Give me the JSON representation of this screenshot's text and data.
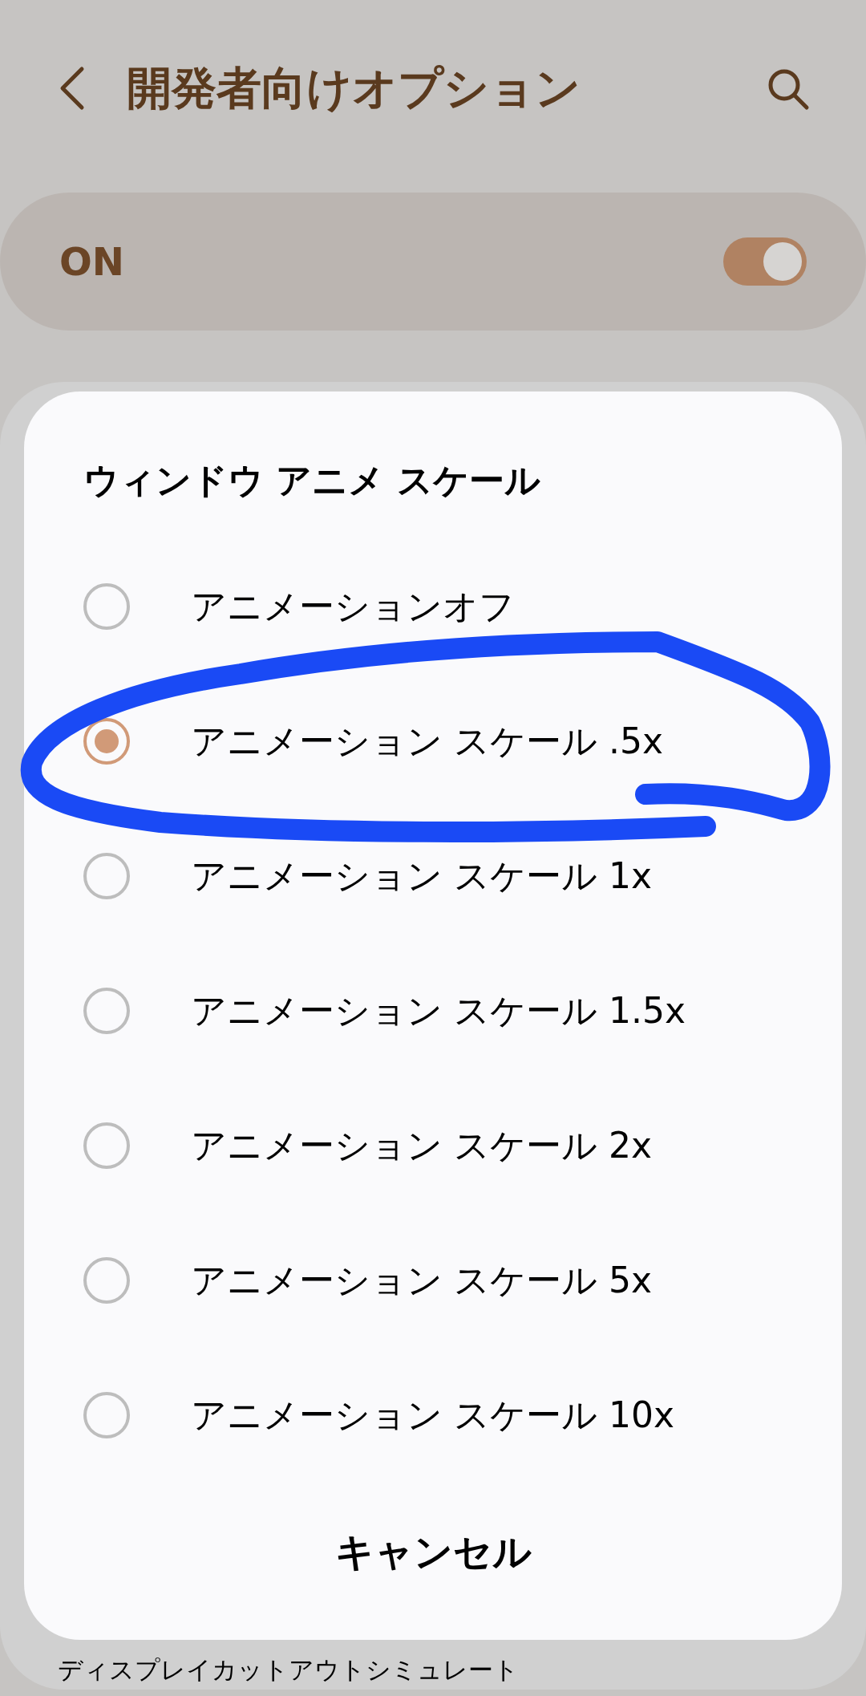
{
  "header": {
    "title": "開発者向けオプション"
  },
  "master_switch": {
    "label": "ON",
    "on": true
  },
  "dialog": {
    "title": "ウィンドウ アニメ スケール",
    "options": [
      {
        "label": "アニメーションオフ",
        "selected": false
      },
      {
        "label": "アニメーション スケール .5x",
        "selected": true
      },
      {
        "label": "アニメーション スケール 1x",
        "selected": false
      },
      {
        "label": "アニメーション スケール 1.5x",
        "selected": false
      },
      {
        "label": "アニメーション スケール 2x",
        "selected": false
      },
      {
        "label": "アニメーション スケール 5x",
        "selected": false
      },
      {
        "label": "アニメーション スケール 10x",
        "selected": false
      }
    ],
    "cancel": "キャンセル"
  },
  "background_item": {
    "label": "ディスプレイカットアウトシミュレート"
  }
}
